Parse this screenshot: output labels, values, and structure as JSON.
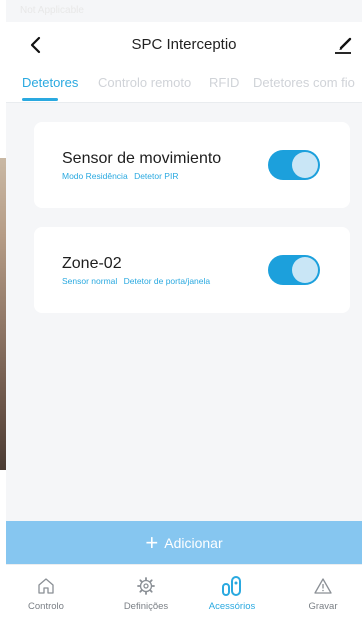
{
  "status_bar": {
    "left": "Not Applicable",
    "center": "",
    "right": ""
  },
  "header": {
    "title": "SPC Interceptio",
    "back_icon": "chevron-left-icon",
    "edit_icon": "edit-icon"
  },
  "tabs": [
    {
      "label": "Detetores",
      "active": true
    },
    {
      "label": "Controlo remoto",
      "active": false
    },
    {
      "label": "RFID",
      "active": false
    },
    {
      "label": "Detetores com fio",
      "active": false
    }
  ],
  "devices": [
    {
      "name": "Sensor de movimiento",
      "mode": "Modo Residência",
      "type": "Detetor PIR",
      "enabled": true
    },
    {
      "name": "Zone-02",
      "mode": "Sensor normal",
      "type": "Detetor de porta/janela",
      "enabled": true
    }
  ],
  "add_button": {
    "label": "Adicionar"
  },
  "bottom_nav": [
    {
      "label": "Controlo",
      "icon": "home-icon",
      "active": false
    },
    {
      "label": "Definições",
      "icon": "gear-icon",
      "active": false
    },
    {
      "label": "Acessórios",
      "icon": "accessories-icon",
      "active": true
    },
    {
      "label": "Gravar",
      "icon": "warning-icon",
      "active": false
    }
  ],
  "colors": {
    "accent": "#2aa9e0",
    "toggle_on": "#1ca0dc",
    "add_bar": "#86c6f0",
    "background": "#f5f6f8"
  }
}
